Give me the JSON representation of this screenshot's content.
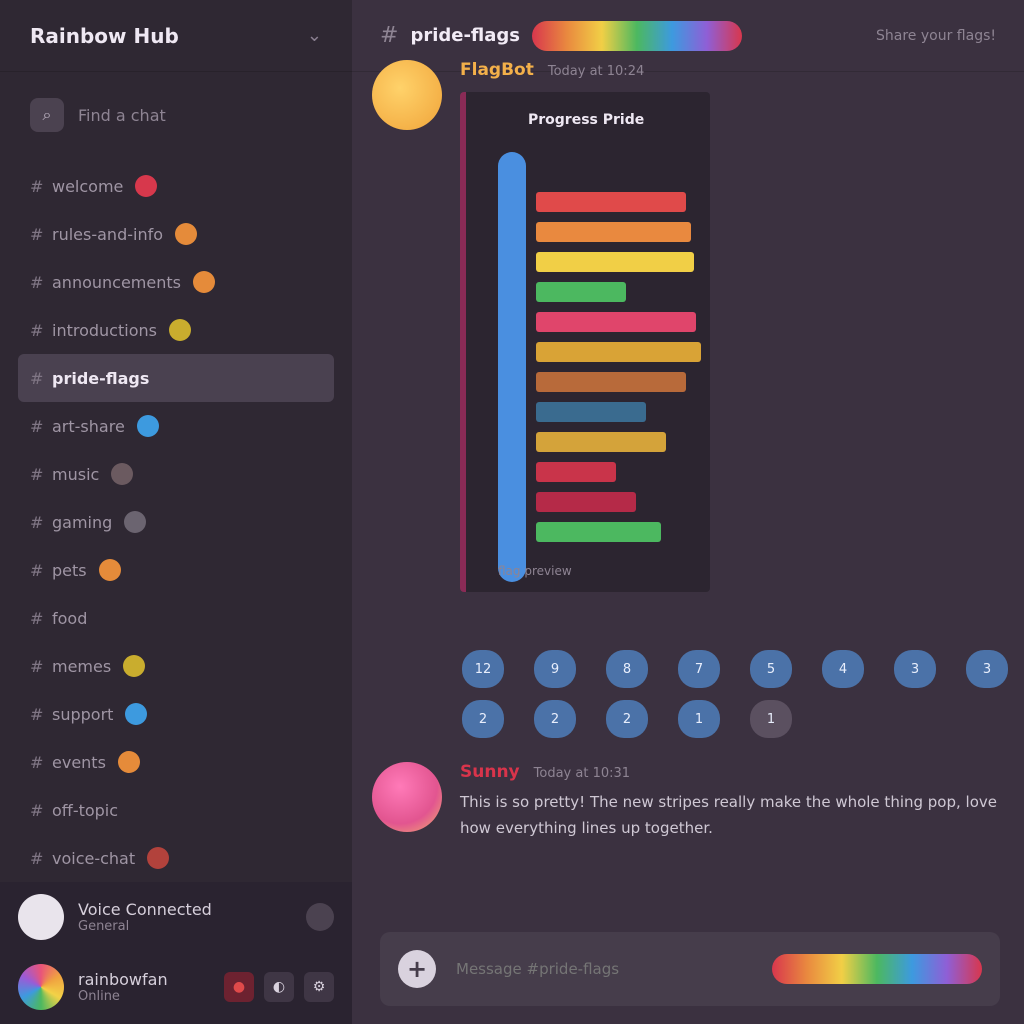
{
  "server": {
    "name": "Rainbow Hub"
  },
  "search": {
    "label": "Find a chat"
  },
  "channels": [
    {
      "name": "welcome",
      "badge": "#d7384c"
    },
    {
      "name": "rules-and-info",
      "badge": "#e58b3a"
    },
    {
      "name": "announcements",
      "badge": "#e58b3a"
    },
    {
      "name": "introductions",
      "badge": "#c9ad2e"
    },
    {
      "name": "pride-flags",
      "badge": ""
    },
    {
      "name": "art-share",
      "badge": "#3d9adf"
    },
    {
      "name": "music",
      "badge": "#6b5a60"
    },
    {
      "name": "gaming",
      "badge": "#6b6470"
    },
    {
      "name": "pets",
      "badge": "#e58b3a"
    },
    {
      "name": "food",
      "badge": ""
    },
    {
      "name": "memes",
      "badge": "#c9ad2e"
    },
    {
      "name": "support",
      "badge": "#3d9adf"
    },
    {
      "name": "events",
      "badge": "#e58b3a"
    },
    {
      "name": "off-topic",
      "badge": ""
    },
    {
      "name": "voice-chat",
      "badge": "#b2423c"
    }
  ],
  "user_panel": {
    "voice": {
      "name": "Voice Connected",
      "status": "General"
    },
    "me": {
      "name": "rainbowfan",
      "status": "Online"
    }
  },
  "topbar": {
    "channel": "pride-flags",
    "topic": "Share your flags!"
  },
  "messages": [
    {
      "author": "FlagBot",
      "author_color": "#f3b04a",
      "time": "Today at 10:24",
      "embed": {
        "title": "Progress Pride",
        "footer": "flag preview",
        "spine_color": "#4a8fe0",
        "bars": [
          "#e04a4a",
          "#e9893f",
          "#f1cf46",
          "#4cb860",
          "#e0456b",
          "#d9a336",
          "#b86a3a",
          "#3a6b8f",
          "#d4a33a",
          "#c9344a",
          "#b52a48",
          "#4cb860"
        ]
      }
    },
    {
      "author": "Sunny",
      "author_color": "#d9344b",
      "time": "Today at 10:31",
      "text": "This is so pretty! The new stripes really make the whole thing pop, love how everything lines up together."
    }
  ],
  "reactions": [
    {
      "count": "12"
    },
    {
      "count": "9"
    },
    {
      "count": "8"
    },
    {
      "count": "7"
    },
    {
      "count": "5"
    },
    {
      "count": "4"
    },
    {
      "count": "3"
    },
    {
      "count": "3"
    },
    {
      "count": "2"
    },
    {
      "count": "2"
    },
    {
      "count": "2"
    },
    {
      "count": "1"
    },
    {
      "count": "1"
    }
  ],
  "composer": {
    "placeholder": "Message #pride-flags"
  }
}
